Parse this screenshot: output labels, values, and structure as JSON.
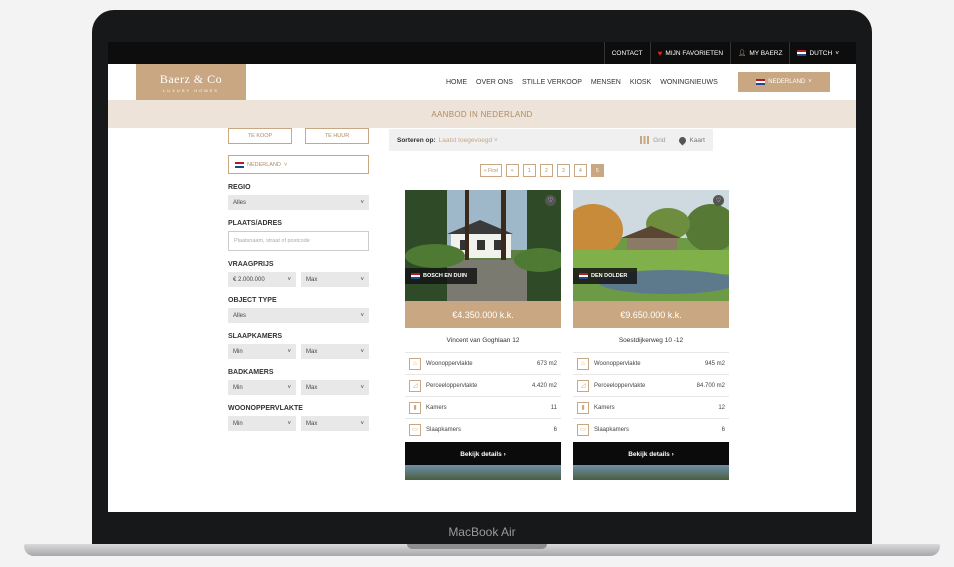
{
  "topbar": {
    "contact": "CONTACT",
    "favorites": "MIJN FAVORIETEN",
    "my_account": "MY BAERZ",
    "language": "DUTCH"
  },
  "brand": {
    "name": "Baerz & Co",
    "tagline": "LUXURY HOMES"
  },
  "menu": [
    {
      "label": "HOME"
    },
    {
      "label": "OVER ONS"
    },
    {
      "label": "STILLE VERKOOP"
    },
    {
      "label": "MENSEN"
    },
    {
      "label": "KIOSK"
    },
    {
      "label": "WONINGNIEUWS"
    }
  ],
  "country_selector": "NEDERLAND",
  "banner_title": "AANBOD IN NEDERLAND",
  "filters": {
    "buy_label": "TE KOOP",
    "rent_label": "TE HUUR",
    "country": "NEDERLAND",
    "regio_label": "REGIO",
    "regio_value": "Alles",
    "place_label": "PLAATS/ADRES",
    "place_placeholder": "Plaatsnaam, straat of postcode",
    "price_label": "VRAAGPRIJS",
    "price_min": "€ 2.000.000",
    "price_max": "Max",
    "type_label": "OBJECT TYPE",
    "type_value": "Alles",
    "bedrooms_label": "SLAAPKAMERS",
    "bedrooms_min": "Min",
    "bedrooms_max": "Max",
    "bathrooms_label": "BADKAMERS",
    "bathrooms_min": "Min",
    "bathrooms_max": "Max",
    "area_label": "WOONOPPERVLAKTE",
    "area_min": "Min",
    "area_max": "Max"
  },
  "sort": {
    "label": "Sorteren op:",
    "value": "Laatst toegevoegd",
    "grid": "Grid",
    "map": "Kaart"
  },
  "pagination": [
    "« First",
    "<",
    "1",
    "2",
    "3",
    "4",
    "5"
  ],
  "listings": [
    {
      "location": "BOSCH EN DUIN",
      "price": "€4.350.000 k.k.",
      "address": "Vincent van Goghlaan 12",
      "features": [
        {
          "label": "Woonoppervlakte",
          "value": "673 m2"
        },
        {
          "label": "Perceeloppervlakte",
          "value": "4.420 m2"
        },
        {
          "label": "Kamers",
          "value": "11"
        },
        {
          "label": "Slaapkamers",
          "value": "6"
        }
      ],
      "cta": "Bekijk details ›"
    },
    {
      "location": "DEN DOLDER",
      "price": "€9.650.000 k.k.",
      "address": "Soestdijkerweg 10 -12",
      "features": [
        {
          "label": "Woonoppervlakte",
          "value": "945 m2"
        },
        {
          "label": "Perceeloppervlakte",
          "value": "84.700 m2"
        },
        {
          "label": "Kamers",
          "value": "12"
        },
        {
          "label": "Slaapkamers",
          "value": "6"
        }
      ],
      "cta": "Bekijk details ›"
    }
  ],
  "device_label": "MacBook Air"
}
